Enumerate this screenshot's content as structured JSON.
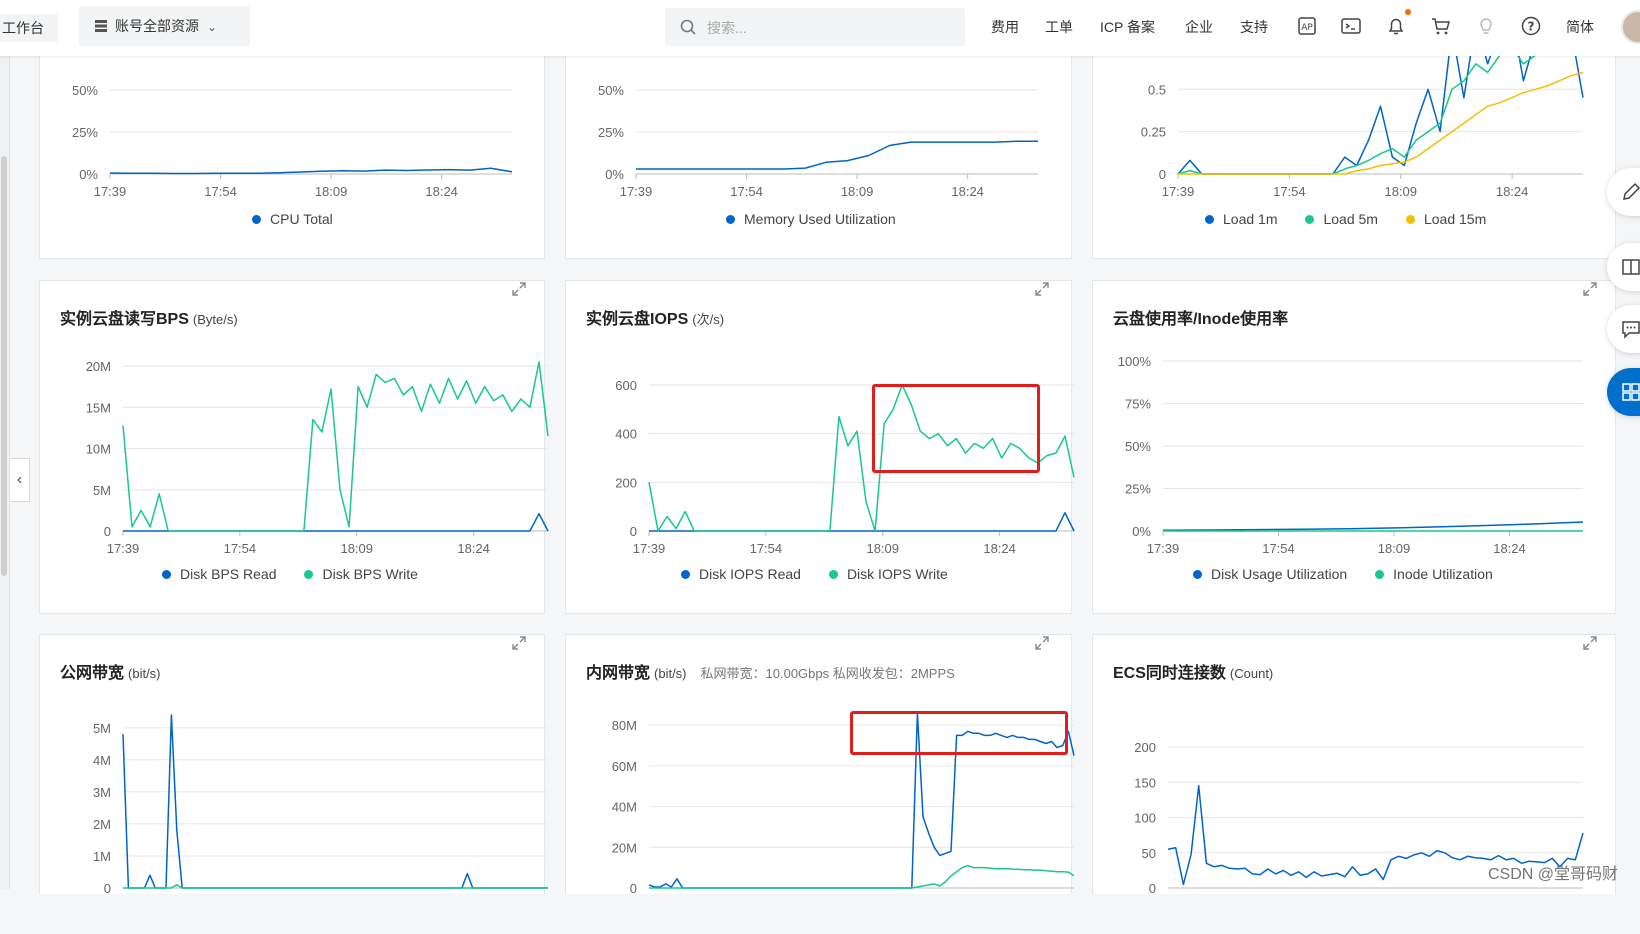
{
  "topbar": {
    "workbench": "工作台",
    "resource_selector": "账号全部资源",
    "search_placeholder": "搜索...",
    "links": [
      "费用",
      "工单",
      "ICP 备案",
      "企业",
      "支持"
    ],
    "language": "简体"
  },
  "charts": {
    "cpu": {
      "legend": [
        "CPU Total"
      ],
      "colors": [
        "#0064c8"
      ],
      "yticks": [
        "50%",
        "25%",
        "0%"
      ],
      "xticks": [
        "17:39",
        "17:54",
        "18:09",
        "18:24"
      ]
    },
    "memory": {
      "legend": [
        "Memory Used Utilization"
      ],
      "colors": [
        "#0064c8"
      ],
      "yticks": [
        "50%",
        "25%",
        "0%"
      ],
      "xticks": [
        "17:39",
        "17:54",
        "18:09",
        "18:24"
      ]
    },
    "load": {
      "legend": [
        "Load 1m",
        "Load 5m",
        "Load 15m"
      ],
      "colors": [
        "#0064c8",
        "#17c98a",
        "#f2c000"
      ],
      "yticks": [
        "0.75",
        "0.5",
        "0.25",
        "0"
      ],
      "xticks": [
        "17:39",
        "17:54",
        "18:09",
        "18:24"
      ]
    },
    "disk_bps": {
      "title": "实例云盘读写BPS",
      "unit": "(Byte/s)",
      "legend": [
        "Disk BPS Read",
        "Disk BPS Write"
      ],
      "colors": [
        "#0064c8",
        "#17c98a"
      ],
      "yticks": [
        "20M",
        "15M",
        "10M",
        "5M",
        "0"
      ],
      "xticks": [
        "17:39",
        "17:54",
        "18:09",
        "18:24"
      ]
    },
    "disk_iops": {
      "title": "实例云盘IOPS",
      "unit": "(次/s)",
      "legend": [
        "Disk IOPS Read",
        "Disk IOPS Write"
      ],
      "colors": [
        "#0064c8",
        "#17c98a"
      ],
      "yticks": [
        "600",
        "400",
        "200",
        "0"
      ],
      "xticks": [
        "17:39",
        "17:54",
        "18:09",
        "18:24"
      ]
    },
    "disk_usage": {
      "title": "云盘使用率/Inode使用率",
      "unit": "",
      "legend": [
        "Disk Usage Utilization",
        "Inode Utilization"
      ],
      "colors": [
        "#0064c8",
        "#17c98a"
      ],
      "yticks": [
        "100%",
        "75%",
        "50%",
        "25%",
        "0%"
      ],
      "xticks": [
        "17:39",
        "17:54",
        "18:09",
        "18:24"
      ]
    },
    "public_bw": {
      "title": "公网带宽",
      "unit": "(bit/s)",
      "colors": [
        "#0064c8",
        "#17c98a"
      ],
      "yticks": [
        "5M",
        "4M",
        "3M",
        "2M",
        "1M",
        "0"
      ]
    },
    "private_bw": {
      "title": "内网带宽",
      "unit": "(bit/s)",
      "extra": "私网带宽：10.00Gbps 私网收发包：2MPPS",
      "colors": [
        "#0064c8",
        "#17c98a"
      ],
      "yticks": [
        "80M",
        "60M",
        "40M",
        "20M",
        "0"
      ]
    },
    "connections": {
      "title": "ECS同时连接数",
      "unit": "(Count)",
      "colors": [
        "#0064c8"
      ],
      "yticks": [
        "200",
        "150",
        "100",
        "50",
        "0"
      ]
    }
  },
  "chart_data": [
    {
      "type": "line",
      "x": [
        "17:39",
        "17:54",
        "18:09",
        "18:24"
      ],
      "ylim": [
        0,
        50
      ],
      "series": [
        {
          "name": "CPU Total",
          "values": [
            0.6,
            0.4,
            0.4,
            0.3,
            0.3,
            0.4,
            0.5,
            0.4,
            0.7,
            1.2,
            1.6,
            1.9,
            1.7,
            2.3,
            2.1,
            2.4,
            2.6,
            2.3,
            3.4,
            1.3
          ]
        }
      ]
    },
    {
      "type": "line",
      "x": [
        "17:39",
        "17:54",
        "18:09",
        "18:24"
      ],
      "ylim": [
        0,
        50
      ],
      "series": [
        {
          "name": "Memory Used Utilization",
          "values": [
            3,
            3,
            3,
            3,
            3,
            3,
            3,
            3,
            3.5,
            7,
            8,
            11,
            17,
            19,
            19,
            19,
            19,
            19,
            19.5,
            19.5
          ]
        }
      ]
    },
    {
      "type": "line",
      "x": [
        "17:39",
        "17:54",
        "18:09",
        "18:24"
      ],
      "ylim": [
        0,
        0.85
      ],
      "series": [
        {
          "name": "Load 1m",
          "values": [
            0,
            0.08,
            0,
            0,
            0,
            0,
            0,
            0,
            0,
            0,
            0,
            0,
            0,
            0,
            0.1,
            0.05,
            0.2,
            0.4,
            0.1,
            0.05,
            0.3,
            0.5,
            0.25,
            0.85,
            0.45,
            0.9,
            0.65,
            0.85,
            0.95,
            0.55,
            0.8,
            0.85,
            0.95,
            0.85,
            0.45
          ]
        },
        {
          "name": "Load 5m",
          "values": [
            0,
            0.02,
            0,
            0,
            0,
            0,
            0,
            0,
            0,
            0,
            0,
            0,
            0,
            0,
            0.03,
            0.05,
            0.08,
            0.12,
            0.15,
            0.1,
            0.2,
            0.25,
            0.3,
            0.5,
            0.55,
            0.65,
            0.6,
            0.7,
            0.75,
            0.65,
            0.7,
            0.72,
            0.8,
            0.75,
            0.7
          ]
        },
        {
          "name": "Load 15m",
          "values": [
            0,
            0,
            0,
            0,
            0,
            0,
            0,
            0,
            0,
            0,
            0,
            0,
            0,
            0,
            0,
            0.02,
            0.03,
            0.05,
            0.06,
            0.07,
            0.1,
            0.15,
            0.2,
            0.25,
            0.3,
            0.35,
            0.4,
            0.42,
            0.45,
            0.48,
            0.5,
            0.52,
            0.55,
            0.58,
            0.6
          ]
        }
      ]
    },
    {
      "type": "line",
      "x": [
        "17:39",
        "17:54",
        "18:09",
        "18:24"
      ],
      "ylim": [
        0,
        20
      ],
      "series": [
        {
          "name": "Disk BPS Read",
          "values": [
            0,
            0,
            0,
            0,
            0,
            0,
            0,
            0,
            0,
            0,
            0,
            0,
            0,
            0,
            0,
            0,
            0,
            0,
            0,
            0,
            0,
            0,
            0,
            0,
            0,
            0,
            0,
            0,
            0,
            0,
            0,
            0,
            0,
            0,
            0,
            0,
            0,
            0,
            0,
            0,
            0,
            0,
            0,
            0,
            0,
            0,
            2.1,
            0
          ]
        },
        {
          "name": "Disk BPS Write",
          "values": [
            12.8,
            0.5,
            2.5,
            0.5,
            4.5,
            0,
            0,
            0,
            0,
            0,
            0,
            0,
            0,
            0,
            0,
            0,
            0,
            0,
            0,
            0,
            0,
            13.5,
            12,
            17.2,
            5,
            0.5,
            17.5,
            15,
            19,
            18,
            18.5,
            16.5,
            17.5,
            14.5,
            17.8,
            15.5,
            18.5,
            16,
            18.2,
            15.5,
            17.5,
            15.8,
            16.5,
            14.5,
            16,
            15,
            20.5,
            11.5
          ]
        }
      ]
    },
    {
      "type": "line",
      "x": [
        "17:39",
        "17:54",
        "18:09",
        "18:24"
      ],
      "ylim": [
        0,
        600
      ],
      "series": [
        {
          "name": "Disk IOPS Read",
          "values": [
            0,
            0,
            0,
            0,
            0,
            0,
            0,
            0,
            0,
            0,
            0,
            0,
            0,
            0,
            0,
            0,
            0,
            0,
            0,
            0,
            0,
            0,
            0,
            0,
            0,
            0,
            0,
            0,
            0,
            0,
            0,
            0,
            0,
            0,
            0,
            0,
            0,
            0,
            0,
            0,
            0,
            0,
            0,
            0,
            0,
            0,
            75,
            0
          ]
        },
        {
          "name": "Disk IOPS Write",
          "values": [
            200,
            0,
            60,
            10,
            80,
            0,
            0,
            0,
            0,
            0,
            0,
            0,
            0,
            0,
            0,
            0,
            0,
            0,
            0,
            0,
            0,
            470,
            350,
            410,
            120,
            0,
            440,
            500,
            600,
            520,
            410,
            380,
            400,
            350,
            380,
            320,
            360,
            340,
            380,
            300,
            360,
            340,
            300,
            280,
            310,
            320,
            390,
            220
          ]
        }
      ]
    },
    {
      "type": "line",
      "x": [
        "17:39",
        "17:54",
        "18:09",
        "18:24"
      ],
      "ylim": [
        0,
        100
      ],
      "series": [
        {
          "name": "Disk Usage Utilization",
          "values": [
            0.5,
            0.6,
            0.8,
            1,
            1.3,
            1.8,
            2.5,
            3.3,
            4.2,
            5.3
          ]
        },
        {
          "name": "Inode Utilization",
          "values": [
            0,
            0,
            0,
            0,
            0,
            0,
            0,
            0,
            0,
            0
          ]
        }
      ]
    },
    {
      "type": "line",
      "ylim": [
        0,
        5
      ],
      "series": [
        {
          "values": [
            4.8,
            0,
            0,
            0,
            0,
            0.4,
            0,
            0,
            0,
            5.4,
            1.8,
            0,
            0,
            0,
            0,
            0,
            0,
            0,
            0,
            0,
            0,
            0,
            0,
            0,
            0,
            0,
            0,
            0,
            0,
            0,
            0,
            0,
            0,
            0,
            0,
            0,
            0,
            0,
            0,
            0,
            0,
            0,
            0,
            0,
            0,
            0,
            0,
            0,
            0,
            0,
            0,
            0,
            0,
            0,
            0,
            0,
            0,
            0,
            0,
            0,
            0,
            0,
            0,
            0,
            0.45,
            0,
            0,
            0,
            0,
            0,
            0,
            0,
            0,
            0,
            0,
            0,
            0,
            0,
            0,
            0
          ]
        },
        {
          "values": [
            0,
            0,
            0,
            0,
            0,
            0,
            0,
            0,
            0,
            0,
            0.1,
            0,
            0,
            0,
            0,
            0,
            0,
            0,
            0,
            0,
            0,
            0,
            0,
            0,
            0,
            0,
            0,
            0,
            0,
            0,
            0,
            0,
            0,
            0,
            0,
            0,
            0,
            0,
            0,
            0,
            0,
            0,
            0,
            0,
            0,
            0,
            0,
            0,
            0,
            0,
            0,
            0,
            0,
            0,
            0,
            0,
            0,
            0,
            0,
            0,
            0,
            0,
            0,
            0,
            0,
            0,
            0,
            0,
            0,
            0,
            0,
            0,
            0,
            0,
            0,
            0,
            0,
            0,
            0,
            0
          ]
        }
      ]
    },
    {
      "type": "line",
      "ylim": [
        0,
        85
      ],
      "series": [
        {
          "values": [
            1.5,
            0.5,
            0.5,
            2,
            0.5,
            4.5,
            0,
            0,
            0,
            0,
            0,
            0,
            0,
            0,
            0,
            0,
            0,
            0,
            0,
            0,
            0,
            0,
            0,
            0,
            0,
            0,
            0,
            0,
            0,
            0,
            0,
            0,
            0,
            0,
            0,
            0,
            0,
            0,
            0,
            0,
            0,
            0,
            0,
            0,
            0,
            0,
            0,
            0,
            86,
            35,
            27,
            20,
            16,
            17,
            18,
            75,
            75,
            77,
            76,
            76,
            75,
            75,
            76,
            75,
            74,
            75,
            74,
            74,
            73,
            73,
            72,
            71,
            72,
            69,
            70,
            77,
            65
          ]
        },
        {
          "values": [
            0,
            0,
            0,
            0,
            0,
            0,
            0,
            0,
            0,
            0,
            0,
            0,
            0,
            0,
            0,
            0,
            0,
            0,
            0,
            0,
            0,
            0,
            0,
            0,
            0,
            0,
            0,
            0,
            0,
            0,
            0,
            0,
            0,
            0,
            0,
            0,
            0,
            0,
            0,
            0,
            0,
            0,
            0,
            0,
            0,
            0,
            0,
            0,
            0.5,
            1,
            1.5,
            2,
            1,
            3,
            6,
            8,
            10,
            11,
            10,
            10,
            10,
            9.8,
            9.5,
            9.5,
            9.5,
            9.3,
            9.2,
            9,
            9,
            8.8,
            8.8,
            8.5,
            8.3,
            8,
            8,
            7.8,
            6
          ]
        }
      ]
    },
    {
      "type": "line",
      "ylim": [
        0,
        200
      ],
      "series": [
        {
          "values": [
            55,
            57,
            5,
            48,
            145,
            35,
            30,
            32,
            28,
            27,
            28,
            20,
            19,
            27,
            20,
            25,
            18,
            23,
            15,
            23,
            17,
            19,
            21,
            16,
            30,
            18,
            20,
            27,
            12,
            40,
            45,
            42,
            47,
            50,
            45,
            53,
            50,
            43,
            40,
            45,
            43,
            42,
            40,
            46,
            40,
            42,
            35,
            38,
            37,
            36,
            42,
            30,
            42,
            40,
            78
          ]
        }
      ]
    }
  ]
}
